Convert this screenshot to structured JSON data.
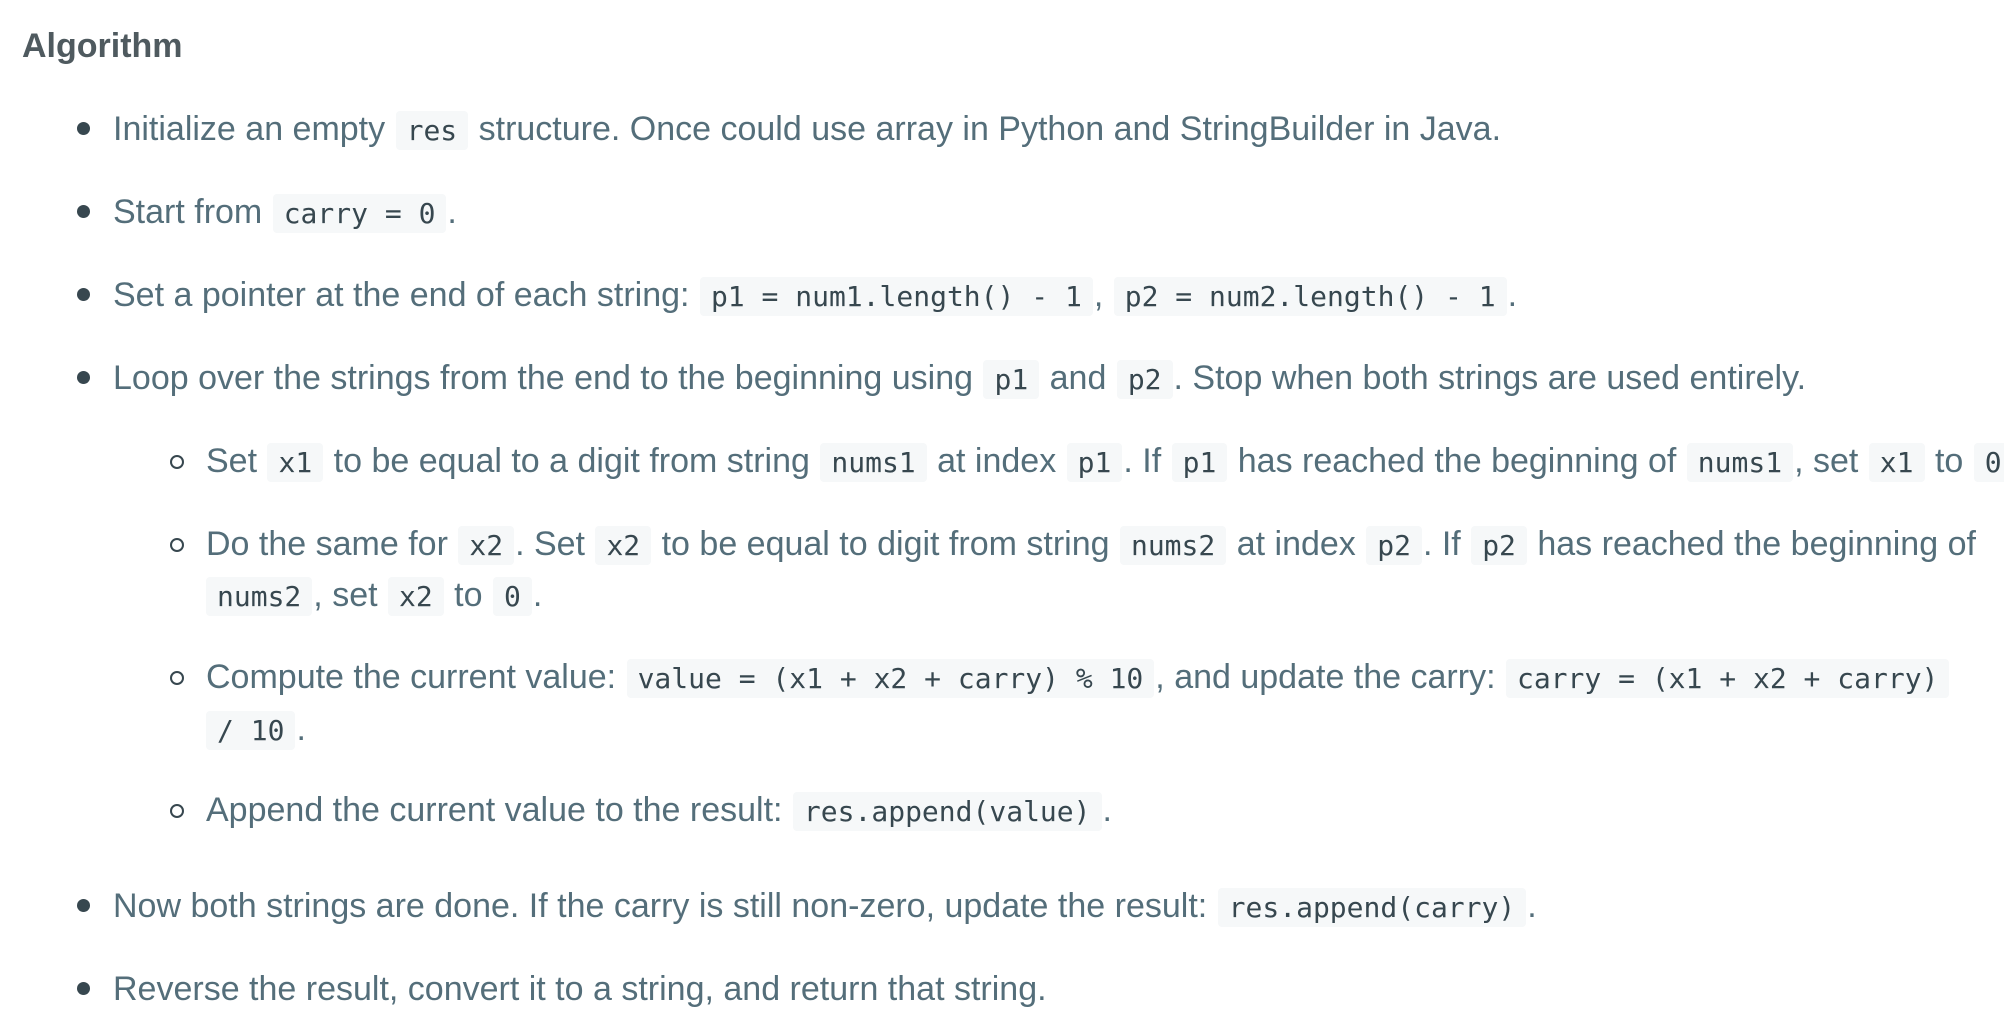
{
  "section": {
    "title": "Algorithm"
  },
  "steps": [
    {
      "t0": "Initialize an empty ",
      "c1": "res",
      "t2": " structure. Once could use array in Python and StringBuilder in Java."
    },
    {
      "t0": "Start from ",
      "c1": "carry = 0",
      "t2": "."
    },
    {
      "t0": "Set a pointer at the end of each string: ",
      "c1": "p1 = num1.length() - 1",
      "t2": ", ",
      "c3": "p2 = num2.length() - 1",
      "t4": "."
    },
    {
      "t0": "Loop over the strings from the end to the beginning using ",
      "c1": "p1",
      "t2": " and ",
      "c3": "p2",
      "t4": ". Stop when both strings are used entirely."
    },
    {
      "t0": "Now both strings are done. If the carry is still non-zero, update the result: ",
      "c1": "res.append(carry)",
      "t2": "."
    },
    {
      "t0": "Reverse the result, convert it to a string, and return that string."
    }
  ],
  "substeps": [
    {
      "t0": "Set ",
      "c1": "x1",
      "t2": " to be equal to a digit from string ",
      "c3": "nums1",
      "t4": " at index ",
      "c5": "p1",
      "t6": ". If ",
      "c7": "p1",
      "t8": " has reached the beginning of ",
      "c9": "nums1",
      "t10": ", set ",
      "c11": "x1",
      "t12": " to ",
      "c13": "0",
      "t14": "."
    },
    {
      "t0": "Do the same for ",
      "c1": "x2",
      "t2": ". Set ",
      "c3": "x2",
      "t4": " to be equal to digit from string ",
      "c5": "nums2",
      "t6": " at index ",
      "c7": "p2",
      "t8": ". If ",
      "c9": "p2",
      "t10": " has reached the beginning of",
      "c11": "nums2",
      "t12": ", set ",
      "c13": "x2",
      "t14": " to ",
      "c15": "0",
      "t16": "."
    },
    {
      "t0": "Compute the current value: ",
      "c1": "value = (x1 + x2 + carry) % 10",
      "t2": ", and update the carry: ",
      "c3": "carry = (x1 + x2 + carry)",
      "c4": "/ 10",
      "t5": "."
    },
    {
      "t0": "Append the current value to the result: ",
      "c1": "res.append(value)",
      "t2": "."
    }
  ]
}
